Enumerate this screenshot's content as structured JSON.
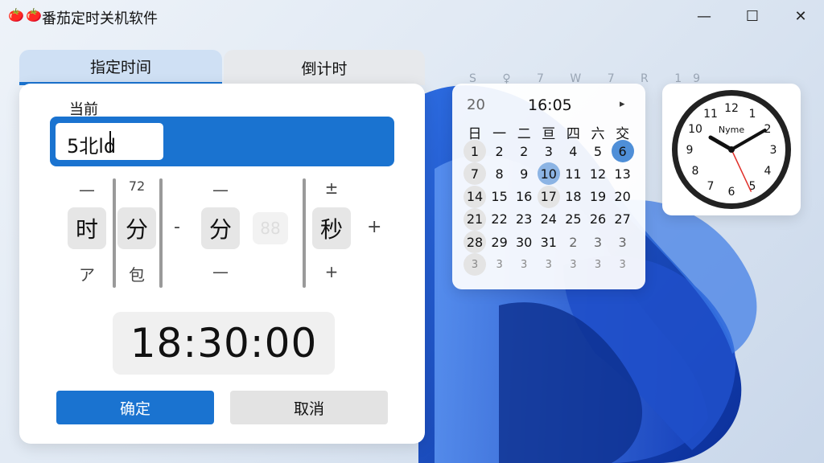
{
  "window": {
    "icons": [
      "tomato-icon",
      "tomato-icon"
    ],
    "title": "番茄定时关机软件",
    "minimize": "—",
    "maximize": "☐",
    "close": "✕"
  },
  "tabs": [
    {
      "label": "指定时间",
      "active": true
    },
    {
      "label": "倒计时",
      "active": false
    }
  ],
  "panel": {
    "current_label": "当前",
    "input_value": "5北ld",
    "pickers": {
      "hour": {
        "top": "—",
        "value": "时",
        "bottom": "ア"
      },
      "minute_a": {
        "top": "72",
        "value": "分",
        "bottom": "包"
      },
      "minute_b": {
        "top": "—",
        "value": "分",
        "bottom": "—"
      },
      "faint": {
        "value": "88"
      },
      "second": {
        "top": "±",
        "value": "秒",
        "bottom": "+"
      },
      "sep_left": "-",
      "sep_right": "+"
    },
    "time_display": "18:30:00",
    "ok_label": "确定",
    "cancel_label": "取消"
  },
  "calendar": {
    "week_strip": "S ♀ 7 W 7 R 19",
    "prev": "20",
    "title": "16:05",
    "next": "▸",
    "headers": [
      "日",
      "一",
      "二",
      "亘",
      "四",
      "六",
      "交"
    ],
    "rows": [
      [
        "1",
        "2",
        "2",
        "3",
        "4",
        "5",
        "6"
      ],
      [
        "7",
        "8",
        "9",
        "10",
        "11",
        "12",
        "13"
      ],
      [
        "14",
        "15",
        "16",
        "17",
        "18",
        "19",
        "20"
      ],
      [
        "21",
        "22",
        "23",
        "24",
        "25",
        "26",
        "27"
      ],
      [
        "28",
        "29",
        "30",
        "31",
        "2",
        "3",
        "3"
      ],
      [
        "3",
        "3",
        "3",
        "3",
        "3",
        "3",
        "3"
      ]
    ]
  },
  "clock": {
    "label": "Nyme",
    "numerals": [
      "12",
      "1",
      "2",
      "3",
      "4",
      "5",
      "6",
      "7",
      "8",
      "9",
      "10",
      "11"
    ],
    "hour_hand_deg": 300,
    "minute_hand_deg": 60,
    "second_hand_deg": 155
  },
  "colors": {
    "accent": "#1a73d0",
    "selected_day": "#4f8fd8",
    "second_hand": "#e0302a"
  }
}
